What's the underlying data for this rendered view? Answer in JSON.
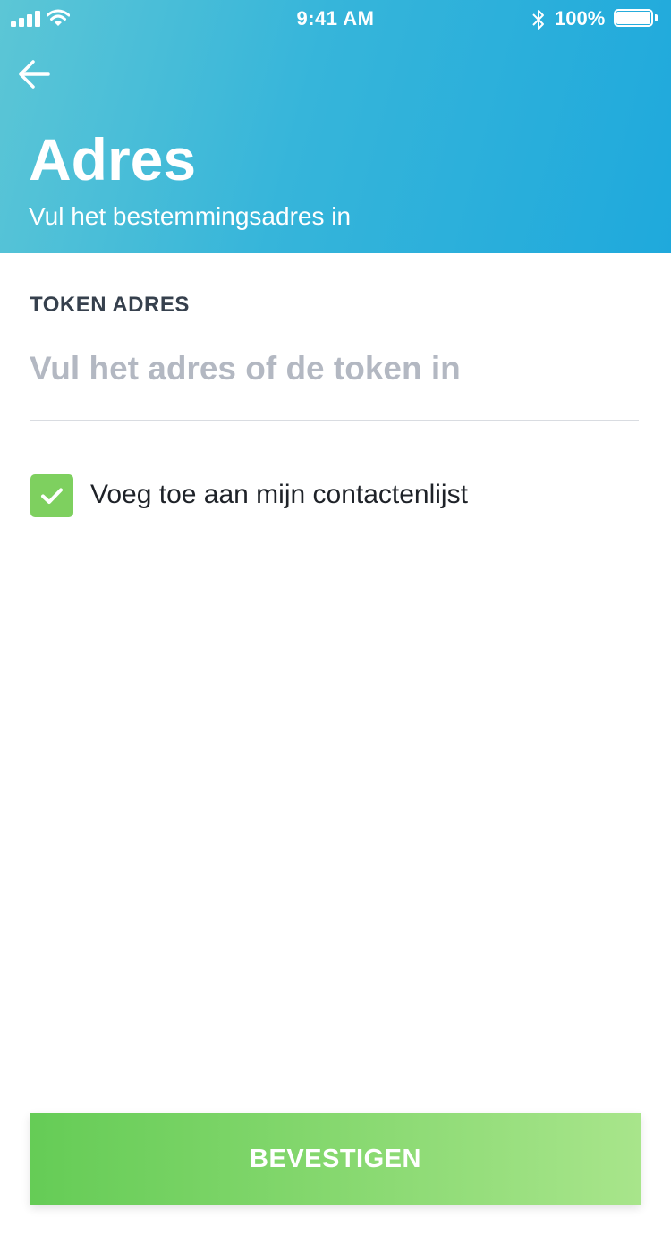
{
  "status_bar": {
    "time": "9:41 AM",
    "battery_percent": "100%",
    "icons": [
      "signal-icon",
      "wifi-icon",
      "bluetooth-icon",
      "battery-icon"
    ]
  },
  "header": {
    "back_icon": "arrow-left-icon",
    "title": "Adres",
    "subtitle": "Vul het bestemmingsadres in"
  },
  "form": {
    "token_label": "TOKEN ADRES",
    "token_input": {
      "value": "",
      "placeholder": "Vul het adres of de token in"
    },
    "add_to_contacts": {
      "checked": true,
      "label": "Voeg toe aan mijn contactenlijst",
      "icon": "checkmark-icon"
    }
  },
  "actions": {
    "confirm_label": "BEVESTIGEN"
  },
  "colors": {
    "header_gradient_start": "#5cc6d6",
    "header_gradient_end": "#1fa9dc",
    "checkbox_green": "#7ed05f",
    "button_gradient_start": "#65cc56",
    "button_gradient_end": "#a8e58b",
    "label_dark": "#36404d",
    "placeholder_gray": "#b3b8c2"
  }
}
